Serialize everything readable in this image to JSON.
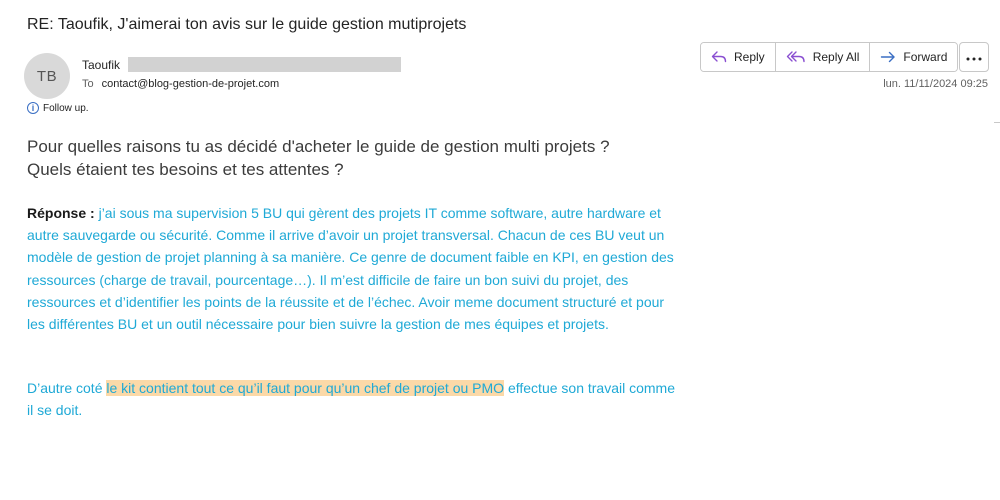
{
  "email": {
    "subject": "RE: Taoufik, J'aimerai ton avis sur le guide gestion mutiprojets",
    "avatar_initials": "TB",
    "sender_name": "Taoufik",
    "to_label": "To",
    "to_address": "contact@blog-gestion-de-projet.com",
    "follow_up": "Follow up.",
    "date": "lun. 11/11/2024 09:25"
  },
  "actions": {
    "reply": "Reply",
    "reply_all": "Reply All",
    "forward": "Forward"
  },
  "body": {
    "question_line1": "Pour quelles raisons tu as décidé d'acheter le guide de gestion multi projets ?",
    "question_line2": "Quels étaient tes besoins et tes attentes ?",
    "response_label": "Réponse :",
    "response_text": " j’ai sous ma supervision 5 BU qui gèrent des projets IT comme software, autre hardware et autre sauvegarde ou sécurité. Comme il arrive d’avoir un projet transversal. Chacun de ces BU veut un modèle de gestion de projet planning à sa manière. Ce genre de document faible en KPI, en gestion des ressources (charge de travail, pourcentage…). Il m’est difficile de faire un bon suivi du projet, des ressources et d’identifier les points de la réussite et de l’échec.   Avoir meme document structuré et pour les différentes BU et un outil nécessaire pour bien suivre la gestion de mes équipes et projets.",
    "conclusion_prefix": "D’autre coté ",
    "conclusion_highlight": "le kit contient tout ce qu’il faut pour qu’un chef de projet ou PMO",
    "conclusion_suffix": " effectue son travail comme il se doit."
  },
  "colors": {
    "response_text": "#1fa9d6",
    "highlight": "#fbd9a8",
    "reply_icon": "#8a4fd1",
    "forward_icon": "#3a6fc4"
  }
}
